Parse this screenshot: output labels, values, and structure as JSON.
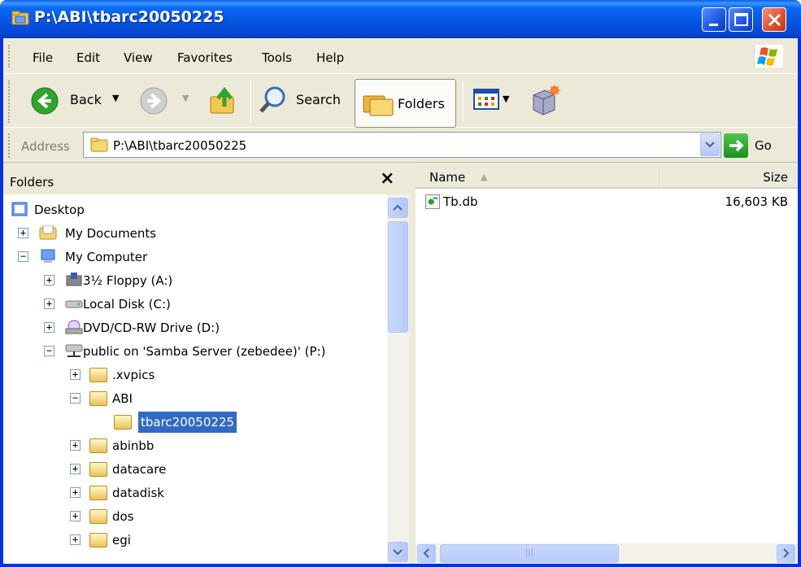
{
  "window": {
    "title": "P:\\ABI\\tbarc20050225"
  },
  "menu": [
    "File",
    "Edit",
    "View",
    "Favorites",
    "Tools",
    "Help"
  ],
  "toolbar": {
    "back_label": "Back",
    "search_label": "Search",
    "folders_label": "Folders"
  },
  "address": {
    "label": "Address",
    "value": "P:\\ABI\\tbarc20050225",
    "go_label": "Go"
  },
  "folders_pane": {
    "title": "Folders",
    "close_glyph": "×",
    "tree": [
      {
        "label": "Desktop"
      },
      {
        "label": "My Documents",
        "expander": "+"
      },
      {
        "label": "My Computer",
        "expander": "−"
      },
      {
        "label": "3½ Floppy (A:)",
        "expander": "+"
      },
      {
        "label": "Local Disk (C:)",
        "expander": "+"
      },
      {
        "label": "DVD/CD-RW Drive (D:)",
        "expander": "+"
      },
      {
        "label": "public on 'Samba Server (zebedee)' (P:)",
        "expander": "−"
      },
      {
        "label": ".xvpics",
        "expander": "+"
      },
      {
        "label": "ABI",
        "expander": "−"
      },
      {
        "label": "tbarc20050225",
        "selected": true
      },
      {
        "label": "abinbb",
        "expander": "+"
      },
      {
        "label": "datacare",
        "expander": "+"
      },
      {
        "label": "datadisk",
        "expander": "+"
      },
      {
        "label": "dos",
        "expander": "+"
      },
      {
        "label": "egi",
        "expander": "+"
      }
    ]
  },
  "file_list": {
    "columns": {
      "name": "Name",
      "size": "Size"
    },
    "files": [
      {
        "name": "Tb.db",
        "size": "16,603 KB"
      }
    ]
  },
  "colors": {
    "title_bar": "#0553e0",
    "selection": "#316ac5",
    "chrome": "#ece9d8"
  },
  "icons": [
    "explorer-folder-icon",
    "back-arrow-icon",
    "forward-arrow-icon",
    "up-folder-icon",
    "search-magnifier-icon",
    "folders-icon",
    "views-icon",
    "sync-icon",
    "go-arrow-icon",
    "windows-logo-icon"
  ]
}
